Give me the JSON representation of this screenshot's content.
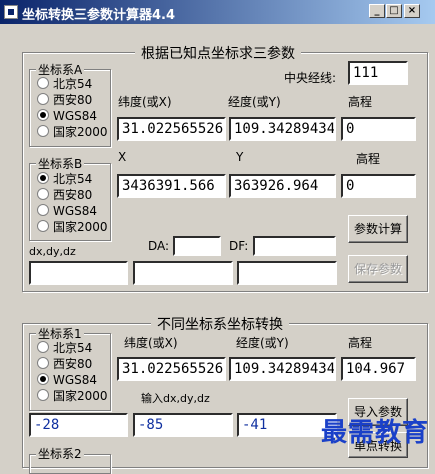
{
  "window": {
    "title": "坐标转换三参数计算器4.4",
    "min_label": "_",
    "max_label": "□",
    "close_label": "×"
  },
  "section1": {
    "title": "根据已知点坐标求三参数",
    "groupA": {
      "title": "坐标系A",
      "options": [
        "北京54",
        "西安80",
        "WGS84",
        "国家2000"
      ],
      "selected": "WGS84"
    },
    "groupB": {
      "title": "坐标系B",
      "options": [
        "北京54",
        "西安80",
        "WGS84",
        "国家2000"
      ],
      "selected": "北京54"
    },
    "central_meridian_label": "中央经线:",
    "central_meridian_value": "111",
    "lat_label": "纬度(或X)",
    "lon_label": "经度(或Y)",
    "height_label": "高程",
    "lat_value": "31.022565526",
    "lon_value": "109.342894343",
    "height_value": "0",
    "x_label": "X",
    "y_label": "Y",
    "height_label_b": "高程",
    "x_value": "3436391.566",
    "y_value": "363926.964",
    "height_value_b": "0",
    "da_label": "DA:",
    "df_label": "DF:",
    "da_value": "",
    "df_value": "",
    "dxdydz_label": "dx,dy,dz",
    "dx_value": "",
    "dy_value": "",
    "dz_value": "",
    "calc_button": "参数计算",
    "save_button": "保存参数"
  },
  "section2": {
    "title": "不同坐标系坐标转换",
    "group1": {
      "title": "坐标系1",
      "options": [
        "北京54",
        "西安80",
        "WGS84",
        "国家2000"
      ],
      "selected": "WGS84"
    },
    "group2": {
      "title": "坐标系2"
    },
    "lat_label": "纬度(或X)",
    "lon_label": "经度(或Y)",
    "height_label": "高程",
    "lat_value": "31.022565526",
    "lon_value": "109.342894343",
    "height_value": "104.967",
    "dxdydz_label": "输入dx,dy,dz",
    "dx_value": "-28",
    "dy_value": "-85",
    "dz_value": "-41",
    "import_button": "导入参数",
    "single_button": "单点转换"
  },
  "watermark": "最需教育"
}
